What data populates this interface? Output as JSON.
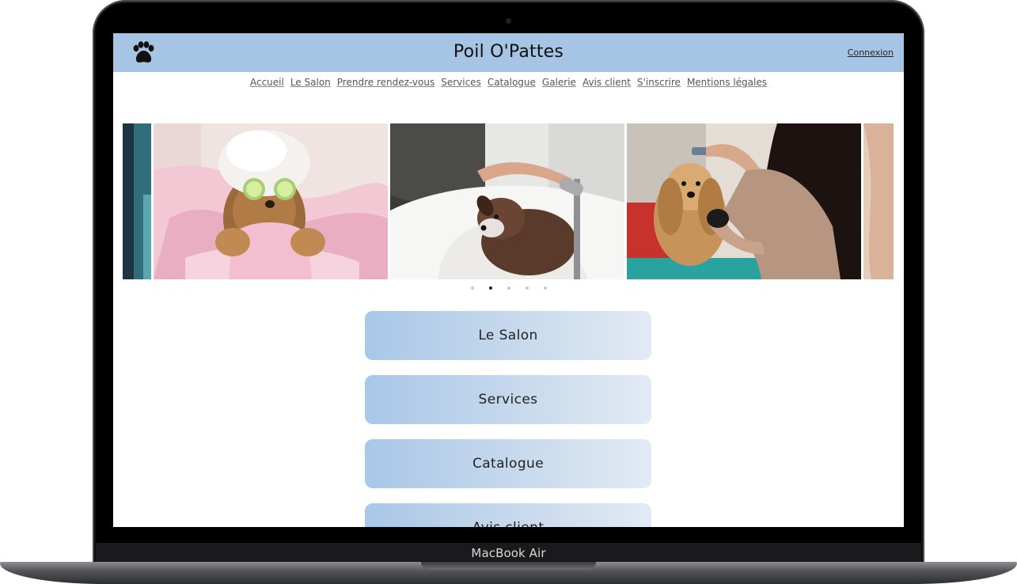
{
  "device": {
    "label": "MacBook Air"
  },
  "site": {
    "title": "Poil O'Pattes",
    "login_label": "Connexion",
    "logo_icon": "paw-icon",
    "header_color": "#a6c4e4"
  },
  "nav": {
    "items": [
      "Accueil",
      "Le Salon",
      "Prendre rendez-vous",
      "Services",
      "Catalogue",
      "Galerie",
      "Avis client",
      "S'inscrire",
      "Mentions légales"
    ]
  },
  "carousel": {
    "slides": [
      "dog wrapped in pink towel with cucumber slices on eyes",
      "wet dog being bathed with shower head",
      "cocker spaniel being brushed by groomer"
    ],
    "dot_count": 5,
    "active_dot": 2
  },
  "menu": {
    "buttons": [
      "Le Salon",
      "Services",
      "Catalogue",
      "Avis client"
    ]
  }
}
